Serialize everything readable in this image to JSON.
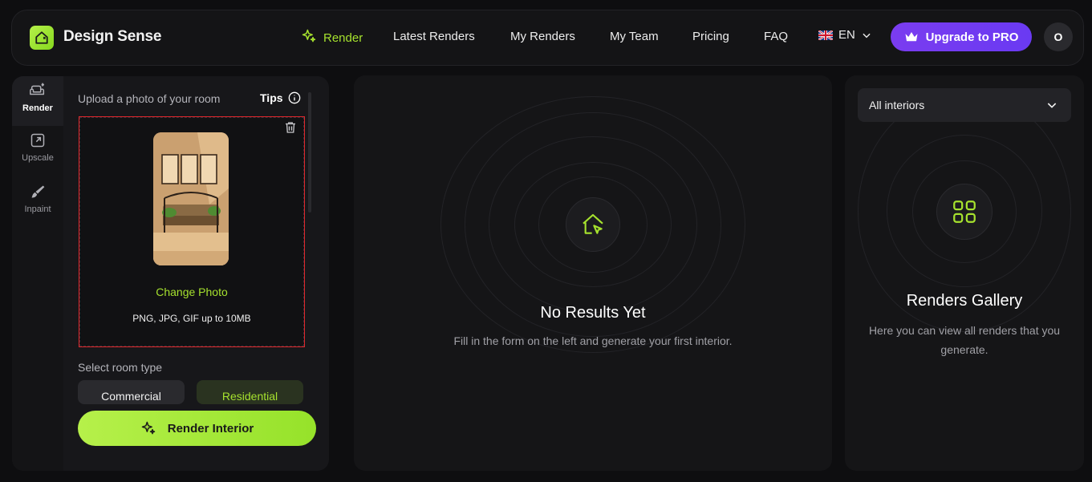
{
  "header": {
    "brand": "Design Sense",
    "nav": [
      {
        "label": "Render",
        "active": true
      },
      {
        "label": "Latest Renders"
      },
      {
        "label": "My Renders"
      },
      {
        "label": "My Team"
      },
      {
        "label": "Pricing"
      },
      {
        "label": "FAQ"
      }
    ],
    "language": "EN",
    "upgrade_label": "Upgrade to PRO",
    "avatar_initial": "O"
  },
  "tools": [
    {
      "label": "Render",
      "icon": "sofa-icon",
      "active": true
    },
    {
      "label": "Upscale",
      "icon": "expand-icon"
    },
    {
      "label": "Inpaint",
      "icon": "brush-icon"
    }
  ],
  "form": {
    "upload_label": "Upload a photo of your room",
    "tips_label": "Tips",
    "change_photo": "Change Photo",
    "formats": "PNG, JPG, GIF up to 10MB",
    "room_type_label": "Select room type",
    "room_types": [
      "Commercial",
      "Residential"
    ],
    "selected_room_type": "Residential",
    "render_button": "Render Interior"
  },
  "results": {
    "title": "No Results Yet",
    "subtitle": "Fill in the form on the left and generate your first interior."
  },
  "gallery": {
    "filter_value": "All interiors",
    "title": "Renders Gallery",
    "subtitle": "Here you can view all renders that you generate."
  },
  "colors": {
    "accent": "#a6e22e",
    "upgrade": "#7a3cf0",
    "background": "#0e0e10"
  }
}
